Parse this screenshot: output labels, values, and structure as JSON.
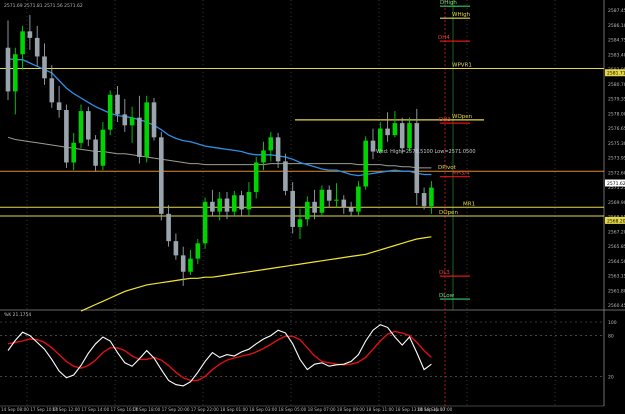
{
  "header": {
    "ohlc": "2571.69 2571.81 2571.56 2571.62"
  },
  "colors": {
    "background": "#000000",
    "bull": "#00d400",
    "bear": "#9aa4ad",
    "ema_fast": "#2e8fe6",
    "sma_slow": "#9aa090",
    "ma_long": "#f3e631",
    "level_yellow": "#e6d84a",
    "level_red": "#e01515",
    "level_orange": "#e09020",
    "stoch_k": "#ffffff",
    "stoch_d": "#e01010",
    "axis_text": "#b8b8b8"
  },
  "chart_data": [
    {
      "type": "candlestick",
      "name": "price",
      "ylim": [
        2560,
        2588
      ],
      "y_ticks": [
        {
          "v": 2587.45,
          "t": "2587.45"
        },
        {
          "v": 2586.1,
          "t": "2586.10"
        },
        {
          "v": 2584.75,
          "t": "2584.75"
        },
        {
          "v": 2583.4,
          "t": "2583.40"
        },
        {
          "v": 2582.05,
          "t": "2582.05"
        },
        {
          "v": 2580.7,
          "t": "2580.70"
        },
        {
          "v": 2579.35,
          "t": "2579.35"
        },
        {
          "v": 2578.0,
          "t": "2578.00"
        },
        {
          "v": 2576.65,
          "t": "2576.65"
        },
        {
          "v": 2575.3,
          "t": "2575.30"
        },
        {
          "v": 2573.95,
          "t": "2573.95"
        },
        {
          "v": 2572.6,
          "t": "2572.60"
        },
        {
          "v": 2571.25,
          "t": "2571.25"
        },
        {
          "v": 2569.9,
          "t": "2569.90"
        },
        {
          "v": 2568.55,
          "t": "2568.55"
        },
        {
          "v": 2567.2,
          "t": "2567.20"
        },
        {
          "v": 2565.85,
          "t": "2565.85"
        },
        {
          "v": 2564.5,
          "t": "2564.50"
        },
        {
          "v": 2563.15,
          "t": "2563.15"
        },
        {
          "v": 2561.8,
          "t": "2561.80"
        },
        {
          "v": 2560.45,
          "t": "2560.45"
        }
      ],
      "price_tags": [
        {
          "v": 2581.71,
          "t": "2581.71",
          "color": "#e6d84a"
        },
        {
          "v": 2571.62,
          "t": "2571.62",
          "color": "#ffffff"
        },
        {
          "v": 2568.2,
          "t": "2568.20",
          "color": "#e6d84a"
        }
      ],
      "candles": [
        [
          2584.0,
          2586.5,
          2579.2,
          2580.0
        ],
        [
          2580.0,
          2584.0,
          2577.9,
          2583.4
        ],
        [
          2583.4,
          2586.0,
          2582.0,
          2585.5
        ],
        [
          2585.5,
          2587.0,
          2583.8,
          2584.9
        ],
        [
          2584.9,
          2586.0,
          2582.3,
          2583.2
        ],
        [
          2583.2,
          2584.4,
          2580.6,
          2581.2
        ],
        [
          2581.2,
          2582.4,
          2578.5,
          2579.0
        ],
        [
          2579.0,
          2580.5,
          2577.6,
          2578.3
        ],
        [
          2578.3,
          2578.8,
          2573.0,
          2573.5
        ],
        [
          2573.5,
          2576.2,
          2572.8,
          2575.3
        ],
        [
          2575.3,
          2578.8,
          2574.8,
          2578.2
        ],
        [
          2578.2,
          2578.6,
          2575.0,
          2575.6
        ],
        [
          2575.6,
          2576.0,
          2572.7,
          2573.2
        ],
        [
          2573.2,
          2577.2,
          2572.8,
          2576.5
        ],
        [
          2576.5,
          2580.1,
          2576.0,
          2579.7
        ],
        [
          2579.7,
          2580.5,
          2577.2,
          2577.9
        ],
        [
          2577.9,
          2579.3,
          2576.3,
          2576.9
        ],
        [
          2576.9,
          2578.6,
          2575.3,
          2577.6
        ],
        [
          2577.6,
          2579.6,
          2573.4,
          2574.0
        ],
        [
          2574.0,
          2579.6,
          2573.5,
          2579.0
        ],
        [
          2579.0,
          2579.4,
          2575.5,
          2575.8
        ],
        [
          2575.8,
          2576.3,
          2568.2,
          2568.8
        ],
        [
          2568.8,
          2569.6,
          2565.8,
          2566.3
        ],
        [
          2566.3,
          2567.0,
          2564.6,
          2565.0
        ],
        [
          2565.0,
          2565.8,
          2562.2,
          2563.5
        ],
        [
          2563.5,
          2565.5,
          2563.2,
          2564.7
        ],
        [
          2564.7,
          2566.5,
          2564.2,
          2566.1
        ],
        [
          2566.1,
          2570.3,
          2565.6,
          2569.9
        ],
        [
          2569.9,
          2571.0,
          2568.6,
          2569.0
        ],
        [
          2569.0,
          2570.8,
          2568.2,
          2570.2
        ],
        [
          2570.2,
          2570.8,
          2568.3,
          2569.0
        ],
        [
          2569.0,
          2570.9,
          2568.6,
          2570.5
        ],
        [
          2570.5,
          2570.9,
          2568.6,
          2569.2
        ],
        [
          2569.2,
          2571.7,
          2568.6,
          2570.8
        ],
        [
          2570.8,
          2574.0,
          2570.2,
          2573.5
        ],
        [
          2573.5,
          2575.4,
          2572.8,
          2574.6
        ],
        [
          2574.6,
          2576.3,
          2573.6,
          2575.8
        ],
        [
          2575.8,
          2576.2,
          2573.0,
          2573.6
        ],
        [
          2573.6,
          2574.3,
          2570.5,
          2570.9
        ],
        [
          2570.9,
          2571.7,
          2567.0,
          2567.6
        ],
        [
          2567.6,
          2569.3,
          2566.5,
          2568.3
        ],
        [
          2568.3,
          2570.4,
          2567.7,
          2569.9
        ],
        [
          2569.9,
          2571.0,
          2568.3,
          2568.9
        ],
        [
          2568.9,
          2571.4,
          2568.6,
          2571.0
        ],
        [
          2571.0,
          2571.4,
          2569.4,
          2570.0
        ],
        [
          2570.0,
          2571.6,
          2569.4,
          2570.1
        ],
        [
          2570.1,
          2570.5,
          2568.8,
          2569.4
        ],
        [
          2569.4,
          2569.9,
          2568.6,
          2569.0
        ],
        [
          2569.0,
          2571.8,
          2568.6,
          2571.3
        ],
        [
          2571.3,
          2575.9,
          2571.0,
          2575.5
        ],
        [
          2575.5,
          2576.6,
          2573.8,
          2574.5
        ],
        [
          2574.5,
          2577.2,
          2574.3,
          2576.6
        ],
        [
          2576.6,
          2578.1,
          2575.4,
          2576.0
        ],
        [
          2576.0,
          2578.2,
          2575.8,
          2577.1
        ],
        [
          2577.1,
          2577.6,
          2574.3,
          2574.8
        ],
        [
          2574.8,
          2577.6,
          2574.5,
          2577.1
        ],
        [
          2577.1,
          2578.4,
          2569.6,
          2570.7
        ],
        [
          2570.7,
          2571.2,
          2569.2,
          2569.5
        ],
        [
          2569.5,
          2571.8,
          2568.8,
          2571.2
        ]
      ],
      "ema_fast": [
        2583.0,
        2582.9,
        2582.9,
        2582.6,
        2582.3,
        2582.0,
        2581.7,
        2581.0,
        2580.3,
        2579.8,
        2579.4,
        2579.0,
        2578.6,
        2578.3,
        2578.0,
        2577.8,
        2577.7,
        2577.6,
        2577.4,
        2577.2,
        2576.9,
        2576.5,
        2576.0,
        2575.7,
        2575.5,
        2575.4,
        2575.2,
        2575.0,
        2574.9,
        2574.8,
        2574.7,
        2574.6,
        2574.5,
        2574.3,
        2574.2,
        2574.2,
        2574.2,
        2574.1,
        2574.0,
        2573.8,
        2573.5,
        2573.3,
        2573.1,
        2572.9,
        2572.8,
        2572.8,
        2572.6,
        2572.4,
        2572.3,
        2572.4,
        2572.5,
        2572.6,
        2572.7,
        2572.8,
        2572.7,
        2572.7,
        2572.5,
        2572.4,
        2572.4
      ],
      "sma_slow": [
        2575.8,
        2575.6,
        2575.5,
        2575.4,
        2575.3,
        2575.2,
        2575.1,
        2575.0,
        2574.9,
        2574.8,
        2574.7,
        2574.6,
        2574.5,
        2574.5,
        2574.4,
        2574.3,
        2574.3,
        2574.2,
        2574.1,
        2574.0,
        2573.9,
        2573.8,
        2573.7,
        2573.6,
        2573.5,
        2573.4,
        2573.4,
        2573.3,
        2573.3,
        2573.3,
        2573.3,
        2573.3,
        2573.3,
        2573.3,
        2573.3,
        2573.3,
        2573.4,
        2573.4,
        2573.4,
        2573.4,
        2573.4,
        2573.4,
        2573.4,
        2573.4,
        2573.4,
        2573.4,
        2573.4,
        2573.4,
        2573.3,
        2573.3,
        2573.3,
        2573.3,
        2573.2,
        2573.2,
        2573.1,
        2573.1,
        2573.0,
        2573.0,
        2573.0
      ],
      "ma_long": [
        null,
        null,
        null,
        null,
        null,
        null,
        null,
        null,
        null,
        null,
        2559.9,
        2560.2,
        2560.5,
        2560.8,
        2561.1,
        2561.4,
        2561.7,
        2561.9,
        2562.1,
        2562.3,
        2562.4,
        2562.5,
        2562.6,
        2562.7,
        2562.8,
        2562.9,
        2562.9,
        2563.0,
        2563.0,
        2563.1,
        2563.2,
        2563.3,
        2563.4,
        2563.5,
        2563.6,
        2563.7,
        2563.8,
        2563.9,
        2564.0,
        2564.1,
        2564.2,
        2564.3,
        2564.4,
        2564.5,
        2564.6,
        2564.7,
        2564.8,
        2564.9,
        2565.0,
        2565.1,
        2565.3,
        2565.5,
        2565.7,
        2565.9,
        2566.1,
        2566.3,
        2566.5,
        2566.6,
        2566.7
      ],
      "levels": [
        {
          "name": "DHigh",
          "price": 2587.8,
          "color": "#2ecc71"
        },
        {
          "name": "WHigh",
          "price": 2586.7,
          "color": "#e6d84a"
        },
        {
          "name": "DH4",
          "price": 2584.6,
          "color": "#e01515"
        },
        {
          "name": "WPVR1",
          "price": 2582.1,
          "color": "#e6d84a"
        },
        {
          "name": "WOpen",
          "price": 2577.4,
          "color": "#e6d84a"
        },
        {
          "name": "DH3",
          "price": 2577.1,
          "color": "#e01515"
        },
        {
          "name": "DPivot",
          "price": 2572.7,
          "color": "#e09020"
        },
        {
          "name": "MH3/4",
          "price": 2572.2,
          "color": "#e01515"
        },
        {
          "name": "MR1",
          "price": 2569.4,
          "color": "#e6d84a"
        },
        {
          "name": "DOpen",
          "price": 2568.6,
          "color": "#e6d84a"
        },
        {
          "name": "DL3",
          "price": 2563.1,
          "color": "#e01515"
        },
        {
          "name": "DLow",
          "price": 2561.0,
          "color": "#2ecc71"
        }
      ],
      "annotation": "Wed:  High=2578.5100 Low=2571.0500"
    },
    {
      "type": "line",
      "name": "stochastic",
      "header_label": "%K 21.1754",
      "ylim": [
        0,
        100
      ],
      "y_ticks": [
        {
          "v": 100,
          "t": "100"
        },
        {
          "v": 80,
          "t": "80"
        },
        {
          "v": 20,
          "t": "20"
        }
      ],
      "series": [
        {
          "values": [
            58,
            73,
            85,
            80,
            70,
            60,
            45,
            28,
            18,
            22,
            36,
            54,
            68,
            78,
            72,
            55,
            40,
            35,
            46,
            58,
            47,
            30,
            14,
            8,
            6,
            12,
            26,
            42,
            55,
            48,
            52,
            50,
            56,
            60,
            68,
            75,
            80,
            88,
            84,
            68,
            45,
            30,
            38,
            40,
            35,
            37,
            38,
            42,
            52,
            72,
            88,
            96,
            92,
            78,
            66,
            78,
            55,
            30,
            38
          ]
        },
        {
          "values": [
            68,
            70,
            72,
            75,
            74,
            70,
            62,
            52,
            42,
            35,
            32,
            36,
            44,
            55,
            62,
            62,
            58,
            50,
            45,
            45,
            48,
            44,
            36,
            26,
            18,
            14,
            14,
            20,
            30,
            38,
            44,
            47,
            50,
            52,
            56,
            61,
            67,
            74,
            79,
            79,
            74,
            62,
            50,
            42,
            40,
            38,
            37,
            38,
            41,
            48,
            60,
            72,
            82,
            86,
            84,
            80,
            70,
            58,
            48
          ]
        }
      ]
    }
  ],
  "time_axis": {
    "labels": [
      "14 Sep 08:00",
      "17 Sep 10:00",
      "17 Sep 12:00",
      "17 Sep 14:00",
      "17 Sep 16:00",
      "17 Sep 18:00",
      "17 Sep 20:00",
      "17 Sep 22:00",
      "18 Sep 01:00",
      "18 Sep 03:00",
      "18 Sep 05:00",
      "18 Sep 07:00",
      "18 Sep 09:00",
      "18 Sep 11:00",
      "18 Sep 13:00",
      "18 Sep 15:00",
      "18 Sep 17:00"
    ],
    "candle_index": [
      0,
      4,
      7,
      11,
      15,
      18,
      22,
      26,
      30,
      34,
      38,
      42,
      46,
      50,
      54,
      57,
      58
    ]
  }
}
